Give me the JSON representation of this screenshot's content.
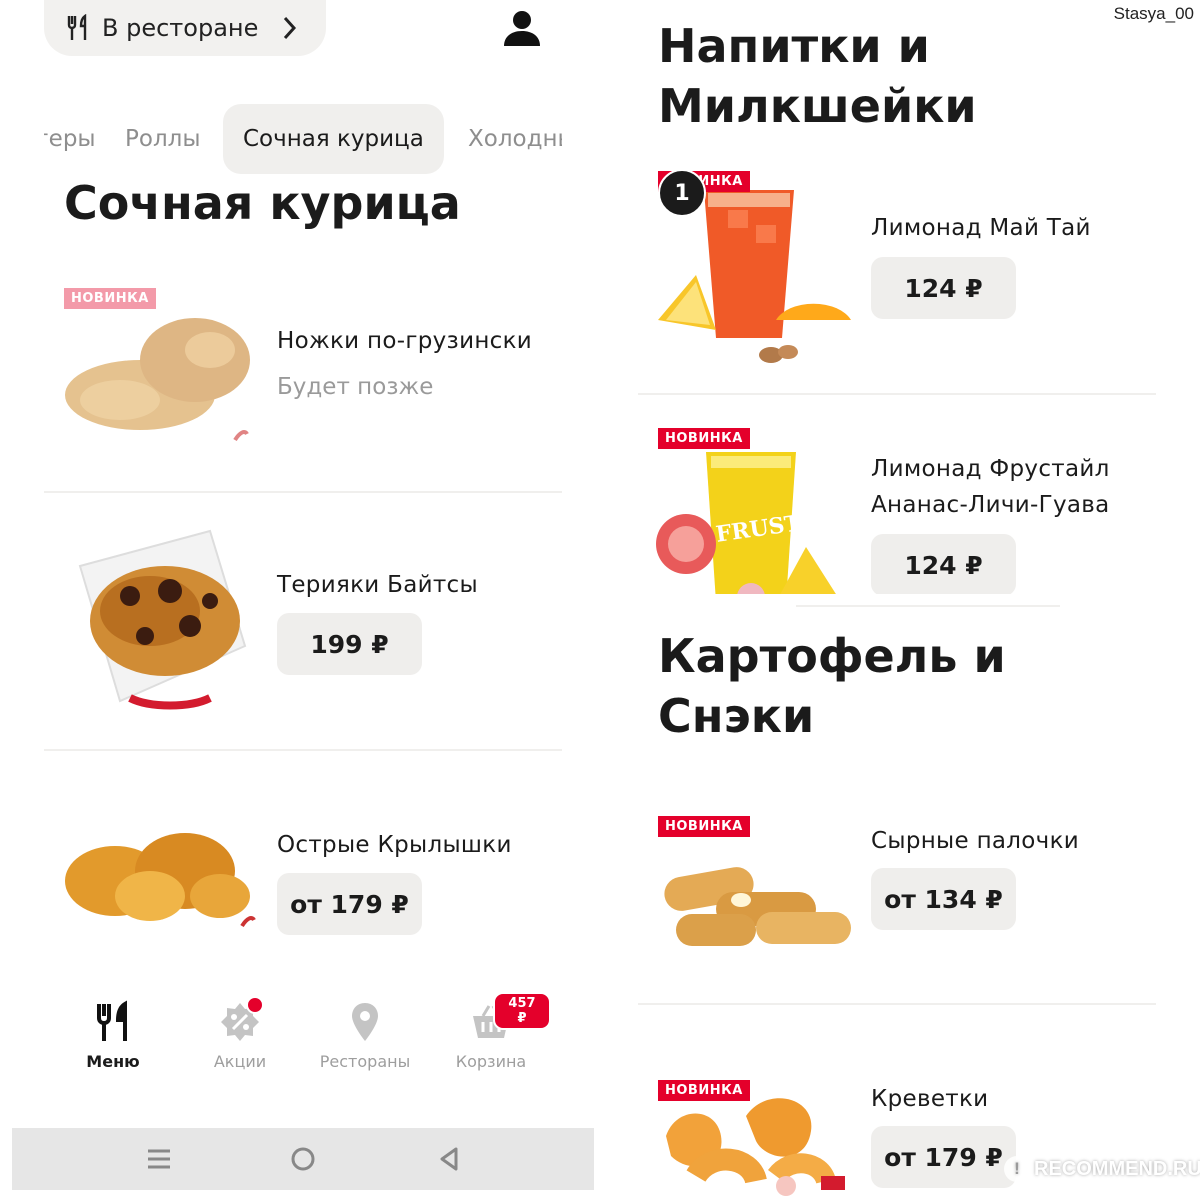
{
  "header": {
    "dining_mode": "В ресторане"
  },
  "tabs": [
    "ргеры",
    "Роллы",
    "Сочная курица",
    "Холодные"
  ],
  "left_section": {
    "title": "Сочная курица",
    "products": [
      {
        "name": "Ножки по-грузински",
        "badge": "НОВИНКА",
        "status": "Будет позже"
      },
      {
        "name": "Терияки Байтсы",
        "price": "199 ₽"
      },
      {
        "name": "Острые Крылышки",
        "price": "от 179 ₽"
      }
    ]
  },
  "bottom_nav": [
    {
      "label": "Меню",
      "icon": "fork-knife-icon",
      "active": true
    },
    {
      "label": "Акции",
      "icon": "discount-tag-icon"
    },
    {
      "label": "Рестораны",
      "icon": "location-pin-icon"
    },
    {
      "label": "Корзина",
      "icon": "basket-icon",
      "badge": "457 ₽"
    }
  ],
  "right_sections": [
    {
      "title_lines": [
        "Напитки и",
        "Милкшейки"
      ],
      "products": [
        {
          "name_lines": [
            "Лимонад Май Тай"
          ],
          "badge": "НОВИНКА",
          "count": "1",
          "price": "124 ₽"
        },
        {
          "name_lines": [
            "Лимонад Фрустайл",
            "Ананас-Личи-Гуава"
          ],
          "badge": "НОВИНКА",
          "price": "124 ₽",
          "image_text": "FRUSTYLE"
        }
      ]
    },
    {
      "title_lines": [
        "Картофель и",
        "Снэки"
      ],
      "products": [
        {
          "name_lines": [
            "Сырные палочки"
          ],
          "badge": "НОВИНКА",
          "price": "от 134 ₽"
        },
        {
          "name_lines": [
            "Креветки"
          ],
          "badge": "НОВИНКА",
          "price": "от 179 ₽"
        }
      ]
    }
  ],
  "username": "Stasya_00",
  "watermark": "RECOMMEND.RU",
  "colors": {
    "accent": "#e4002b",
    "pill_bg": "#efeeec",
    "text": "#1b1b1b",
    "muted": "#9a9a9a"
  }
}
